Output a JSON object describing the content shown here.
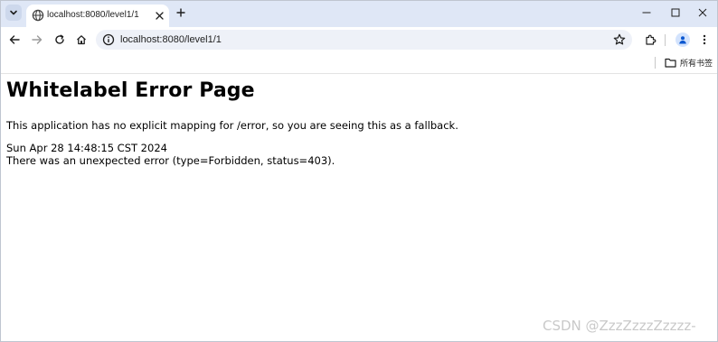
{
  "browser": {
    "tab": {
      "title": "localhost:8080/level1/1"
    },
    "address_bar": {
      "url": "localhost:8080/level1/1"
    },
    "bookmarks_bar": {
      "all_bookmarks_label": "所有书签"
    }
  },
  "page": {
    "heading": "Whitelabel Error Page",
    "message": "This application has no explicit mapping for /error, so you are seeing this as a fallback.",
    "timestamp": "Sun Apr 28 14:48:15 CST 2024",
    "error_detail": "There was an unexpected error (type=Forbidden, status=403)."
  },
  "watermark": "CSDN @ZzzZzzzZzzzz-",
  "colors": {
    "tabstrip_bg": "#dfe7f6",
    "omnibox_bg": "#eef1f8",
    "profile_bg": "#d3e3fd",
    "profile_icon": "#0b57d0",
    "watermark": "#c9c9c9"
  }
}
